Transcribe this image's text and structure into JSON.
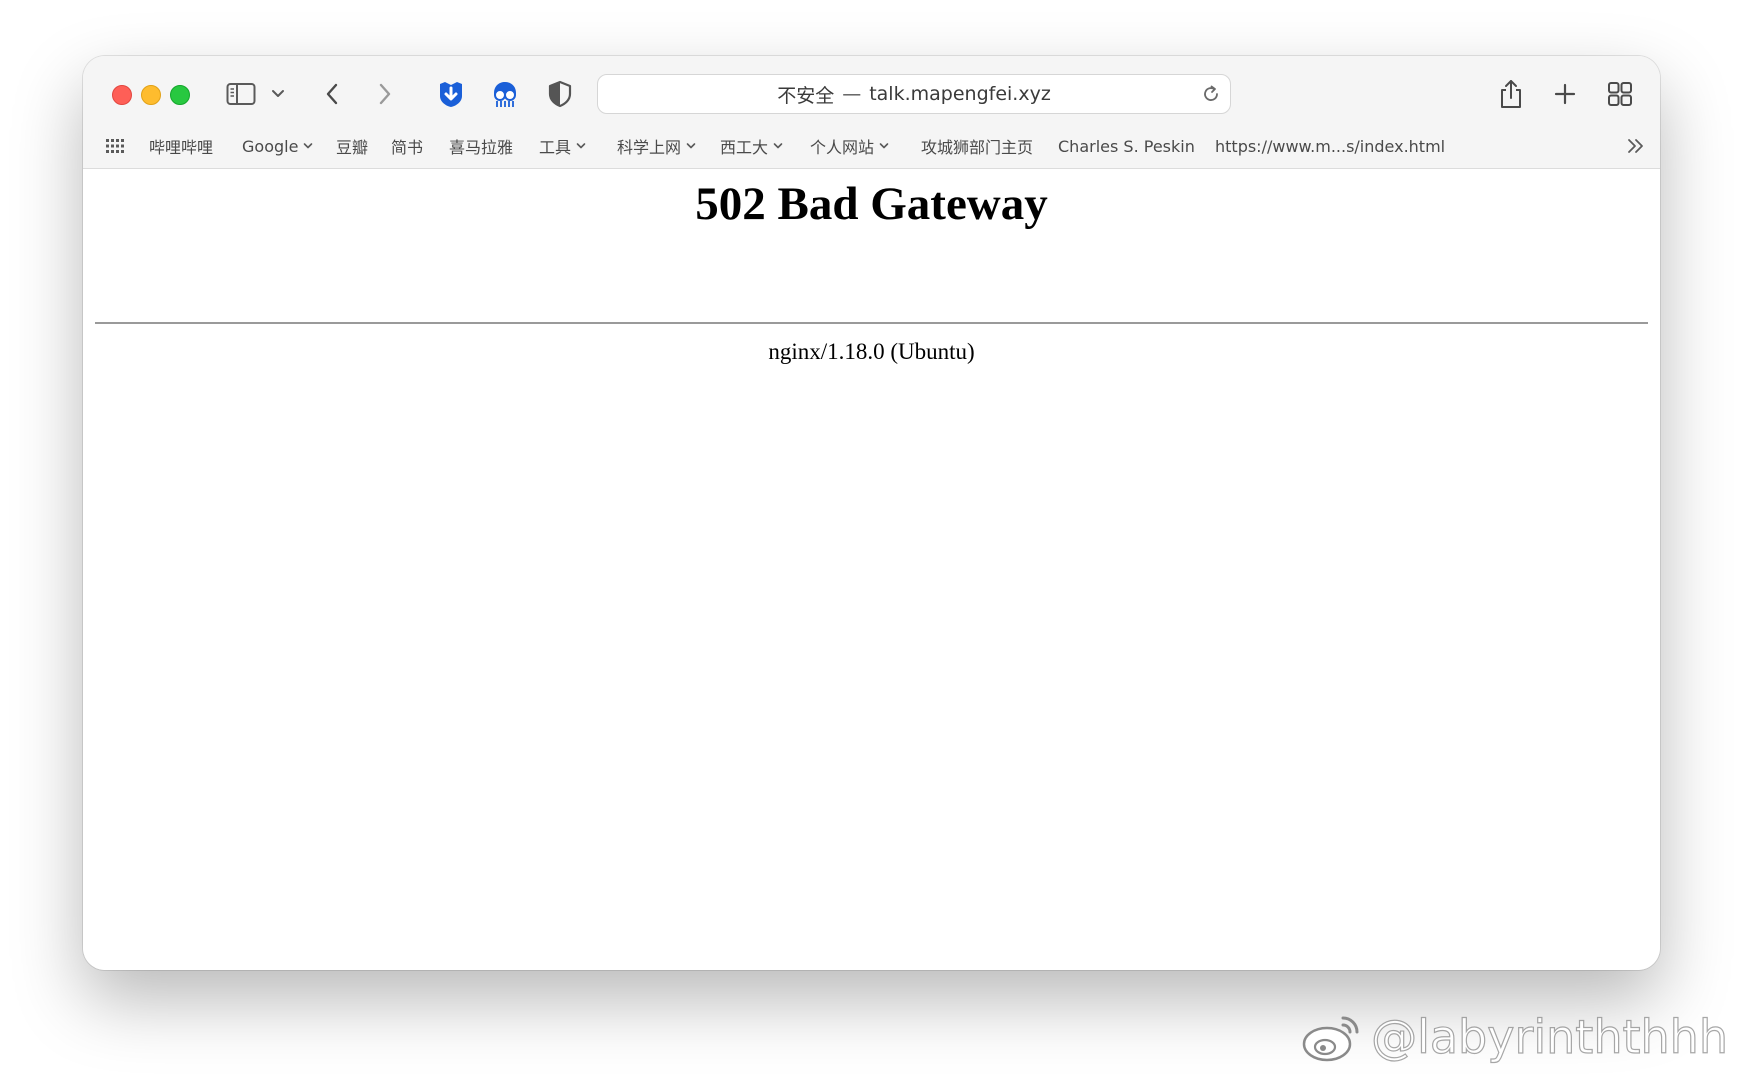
{
  "browser": {
    "address": {
      "security_label": "不安全",
      "separator": "—",
      "host": "talk.mapengfei.xyz"
    },
    "icons": {
      "sidebar": "sidebar-icon",
      "back": "chevron-left-icon",
      "forward": "chevron-right-icon",
      "reload": "reload-icon",
      "share": "share-icon",
      "new_tab": "plus-icon",
      "tab_overview": "tab-overview-icon",
      "bookmarks_apps": "grid-icon",
      "more": "double-chevron-right-icon"
    },
    "extensions": [
      {
        "icon": "download-shield-extension-icon",
        "color": "#1a5fd8"
      },
      {
        "icon": "octocat-extension-icon",
        "color": "#1a5fd8"
      },
      {
        "icon": "shield-extension-icon",
        "color": "#555555"
      }
    ],
    "bookmarks": [
      {
        "label": "哔哩哔哩",
        "folder": false
      },
      {
        "label": "Google",
        "folder": true
      },
      {
        "label": "豆瓣",
        "folder": false
      },
      {
        "label": "简书",
        "folder": false
      },
      {
        "label": "喜马拉雅",
        "folder": false
      },
      {
        "label": "工具",
        "folder": true
      },
      {
        "label": "科学上网",
        "folder": true
      },
      {
        "label": "西工大",
        "folder": true
      },
      {
        "label": "个人网站",
        "folder": true
      },
      {
        "label": "攻城狮部门主页",
        "folder": false
      },
      {
        "label": "Charles S. Peskin",
        "folder": false
      },
      {
        "label": "https://www.m...s/index.html",
        "folder": false
      }
    ]
  },
  "page": {
    "title": "502 Bad Gateway",
    "server": "nginx/1.18.0 (Ubuntu)"
  },
  "watermark": {
    "text": "@labyrinththhh"
  },
  "colors": {
    "close": "#fe5f57",
    "minimize": "#febc2e",
    "maximize": "#28c840",
    "toolbar_bg": "#f5f5f5",
    "extension_blue": "#1a5fd8"
  }
}
